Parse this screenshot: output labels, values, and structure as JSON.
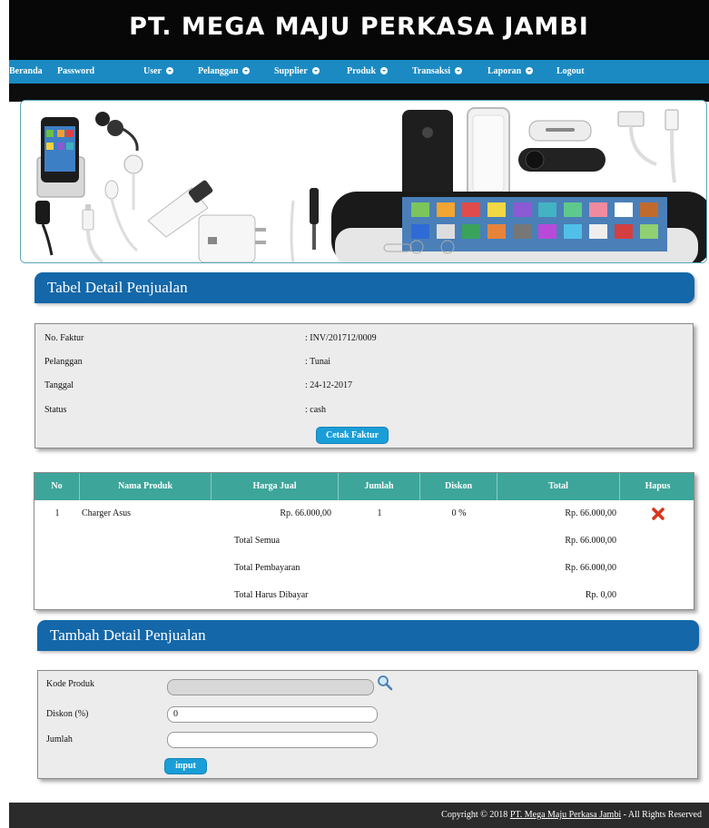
{
  "header": {
    "title": "PT. MEGA MAJU PERKASA JAMBI"
  },
  "nav": {
    "items": [
      {
        "label": "Beranda",
        "dropdown": false
      },
      {
        "label": "Password",
        "dropdown": false
      },
      {
        "label": "User",
        "dropdown": true
      },
      {
        "label": "Pelanggan",
        "dropdown": true
      },
      {
        "label": "Supplier",
        "dropdown": true
      },
      {
        "label": "Produk",
        "dropdown": true
      },
      {
        "label": "Transaksi",
        "dropdown": true
      },
      {
        "label": "Laporan",
        "dropdown": true
      },
      {
        "label": "Logout",
        "dropdown": false
      }
    ]
  },
  "detail": {
    "title": "Tabel Detail Penjualan",
    "fields": [
      {
        "label": "No. Faktur",
        "value": ": INV/201712/0009"
      },
      {
        "label": "Pelanggan",
        "value": ": Tunai"
      },
      {
        "label": "Tanggal",
        "value": ": 24-12-2017"
      },
      {
        "label": "Status",
        "value": ": cash"
      }
    ],
    "print_button": "Cetak Faktur"
  },
  "table": {
    "columns": [
      "No",
      "Nama Produk",
      "Harga Jual",
      "Jumlah",
      "Diskon",
      "Total",
      "Hapus"
    ],
    "rows": [
      {
        "no": "1",
        "nama": "Charger Asus",
        "harga": "Rp. 66.000,00",
        "jumlah": "1",
        "diskon": "0 %",
        "total": "Rp. 66.000,00"
      }
    ],
    "summary": [
      {
        "label": "Total Semua",
        "value": "Rp. 66.000,00"
      },
      {
        "label": "Total Pembayaran",
        "value": "Rp. 66.000,00"
      },
      {
        "label": "Total Harus Dibayar",
        "value": "Rp. 0,00"
      }
    ]
  },
  "form": {
    "title": "Tambah Detail Penjualan",
    "kode_label": "Kode Produk",
    "kode_value": "",
    "diskon_label": "Diskon (%)",
    "diskon_value": "0",
    "jumlah_label": "Jumlah",
    "jumlah_value": "",
    "submit_label": "input"
  },
  "footer": {
    "prefix": "Copyright © 2018 ",
    "link": "PT. Mega Maju Perkasa Jambi",
    "suffix": " - All Rights Reserved"
  },
  "colors": {
    "nav": "#1b8ac2",
    "section": "#1467a8",
    "table_head": "#3da59a",
    "button": "#1a9ed8",
    "delete": "#d9351c"
  }
}
